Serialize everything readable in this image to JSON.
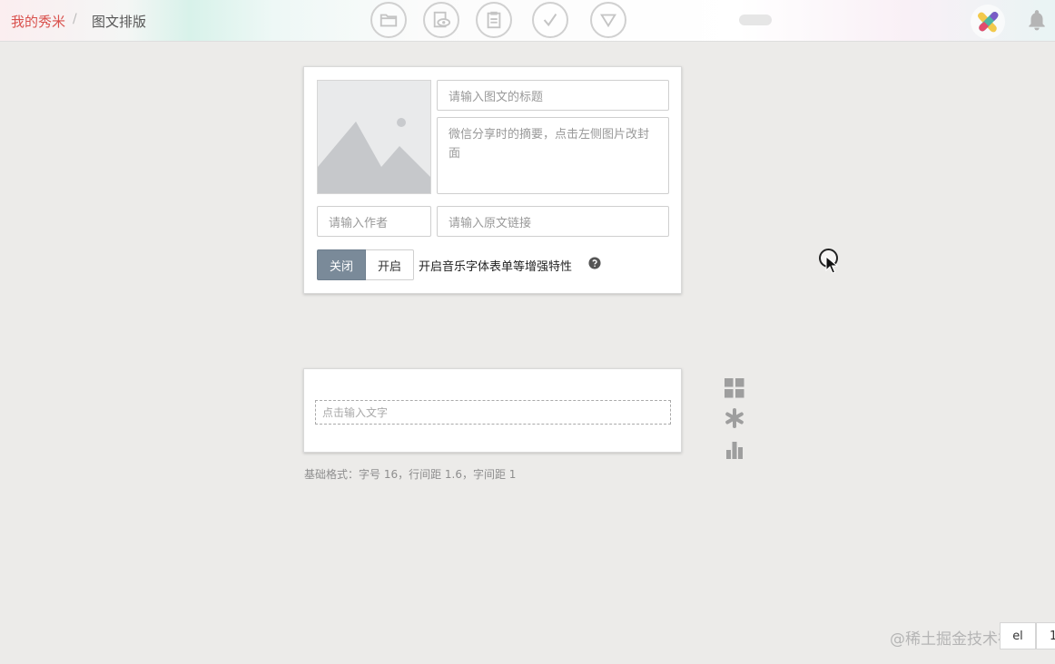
{
  "breadcrumb": {
    "root": "我的秀米",
    "separator": "/",
    "current": "图文排版"
  },
  "toolbar": {
    "items": [
      {
        "icon": "folder-icon"
      },
      {
        "icon": "preview-icon"
      },
      {
        "icon": "clipboard-icon"
      },
      {
        "icon": "check-icon"
      },
      {
        "icon": "triangle-down-icon"
      }
    ]
  },
  "cover": {
    "title_placeholder": "请输入图文的标题",
    "summary_placeholder": "微信分享时的摘要，点击左侧图片改封面",
    "author_placeholder": "请输入作者",
    "link_placeholder": "请输入原文链接",
    "toggle_off": "关闭",
    "toggle_on": "开启",
    "enhance_label": "开启音乐字体表单等增强特性"
  },
  "editor": {
    "text_placeholder": "点击输入文字",
    "format_hint": "基础格式：字号 16，行间距 1.6，字间距 1"
  },
  "colors": {
    "accent": "#d9514d",
    "toggle_active": "#7a8a99"
  },
  "watermark": "@稀土掘金技术社区",
  "corner": {
    "left_label": "el",
    "right_label": "1"
  }
}
